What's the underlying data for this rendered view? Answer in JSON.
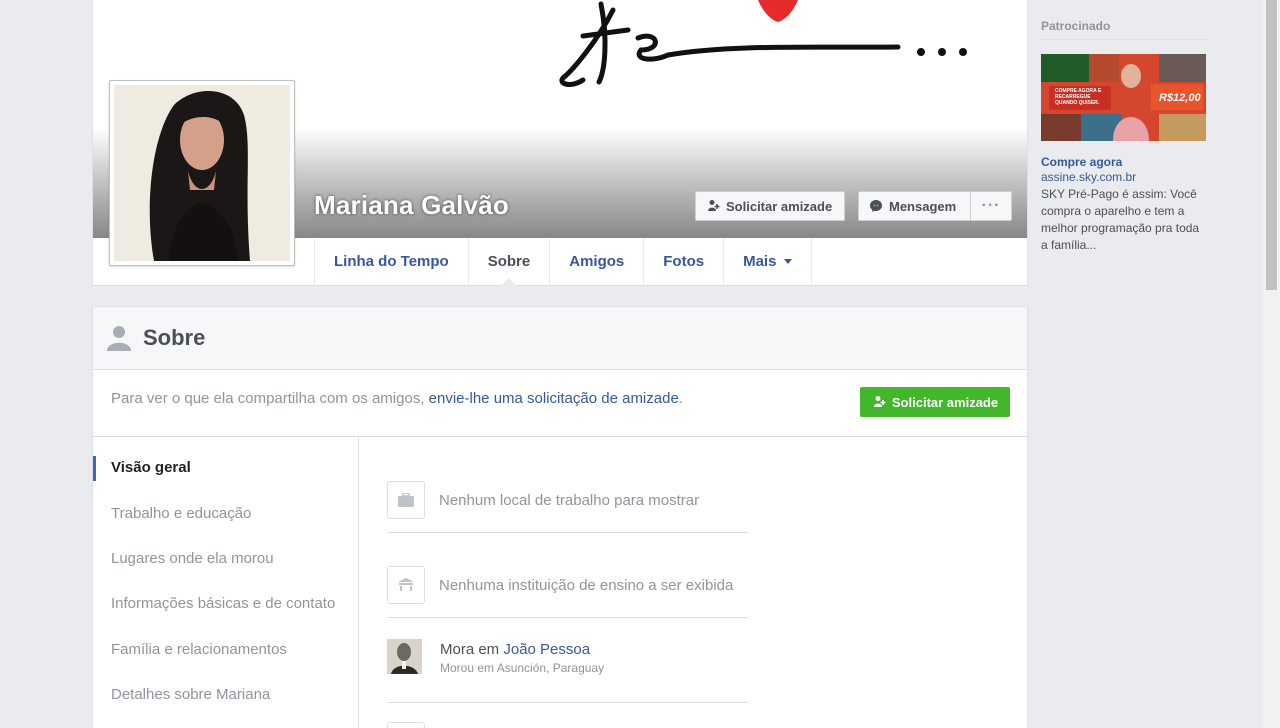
{
  "profile": {
    "name": "Mariana Galvão",
    "add_friend_label": "Solicitar amizade",
    "message_label": "Mensagem",
    "more_label": "···"
  },
  "tabs": [
    {
      "label": "Linha do Tempo"
    },
    {
      "label": "Sobre"
    },
    {
      "label": "Amigos"
    },
    {
      "label": "Fotos"
    },
    {
      "label": "Mais"
    }
  ],
  "about": {
    "title": "Sobre",
    "notice_prefix": "Para ver o que ela compartilha com os amigos, ",
    "notice_link": "envie-lhe uma solicitação de amizade",
    "notice_suffix": ".",
    "add_friend_label": "Solicitar amizade",
    "nav": [
      {
        "label": "Visão geral"
      },
      {
        "label": "Trabalho e educação"
      },
      {
        "label": "Lugares onde ela morou"
      },
      {
        "label": "Informações básicas e de contato"
      },
      {
        "label": "Família e relacionamentos"
      },
      {
        "label": "Detalhes sobre Mariana"
      }
    ],
    "rows": {
      "work": "Nenhum local de trabalho para mostrar",
      "education": "Nenhuma instituição de ensino a ser exibida",
      "lives_prefix": "Mora em ",
      "lives_city": "João Pessoa",
      "lived_before": "Morou em Asunción, Paraguay"
    }
  },
  "ad": {
    "sponsored": "Patrocinado",
    "title": "Compre agora",
    "url": "assine.sky.com.br",
    "description": "SKY Pré-Pago é assim: Você compra o aparelho e tem a melhor programação pra toda a família...",
    "banner_small": "COMPRE AGORA E RECARREGUE QUANDO QUISER.",
    "price": "R$12,00"
  },
  "colors": {
    "link": "#365899",
    "green": "#42b72a",
    "background": "#e9ebee"
  }
}
